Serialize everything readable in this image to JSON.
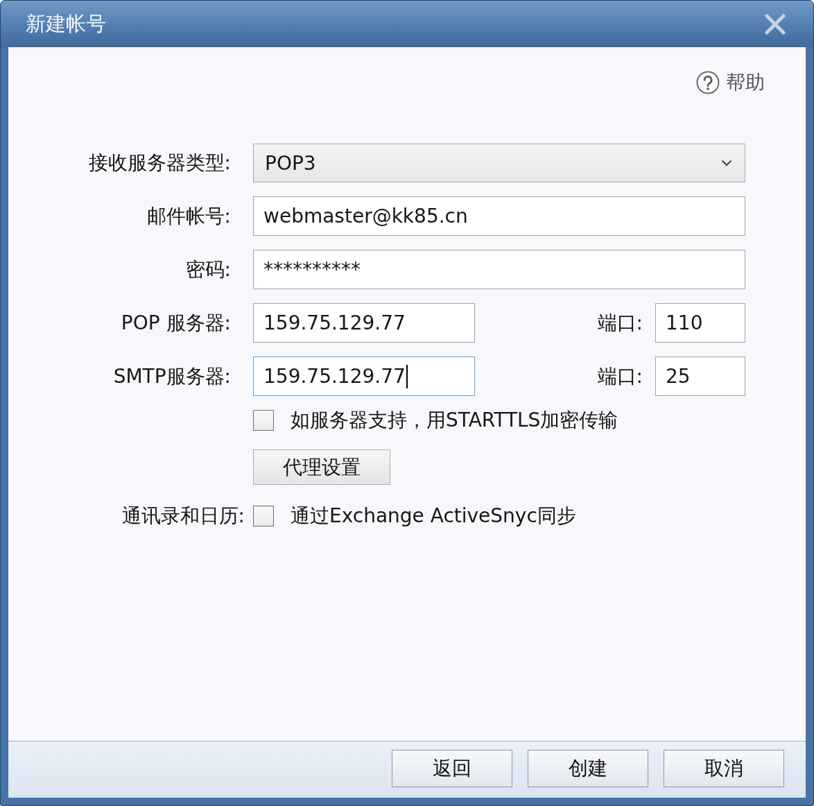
{
  "window": {
    "title": "新建帐号"
  },
  "help": {
    "label": "帮助"
  },
  "fields": [
    {
      "kind": "select",
      "label": "接收服务器类型:",
      "value": "POP3"
    },
    {
      "kind": "text",
      "label": "邮件帐号:",
      "value": "webmaster@kk85.cn"
    },
    {
      "kind": "password",
      "label": "密码:",
      "value": "**********"
    },
    {
      "kind": "server",
      "label": "POP 服务器:",
      "value": "159.75.129.77",
      "focused": false,
      "port_label": "端口:",
      "port": "110"
    },
    {
      "kind": "server",
      "label": "SMTP服务器:",
      "value": "159.75.129.77",
      "focused": true,
      "port_label": "端口:",
      "port": "25"
    }
  ],
  "starttls": {
    "label": "如服务器支持，用STARTTLS加密传输",
    "checked": false
  },
  "proxy_button": "代理设置",
  "sync": {
    "label": "通讯录和日历:",
    "option": "通过Exchange ActiveSnyc同步",
    "checked": false
  },
  "buttons": [
    "返回",
    "创建",
    "取消"
  ]
}
